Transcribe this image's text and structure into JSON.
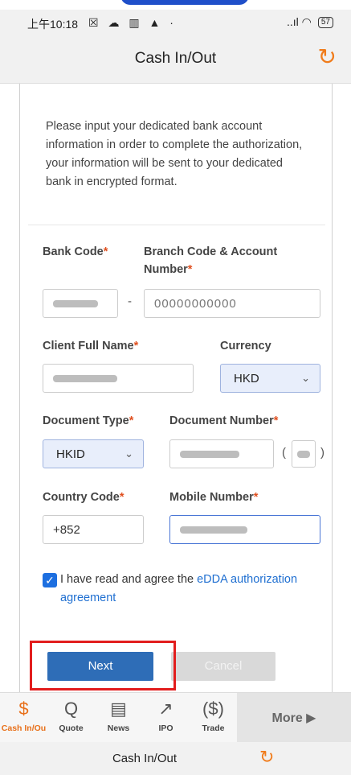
{
  "status": {
    "time": "上午10:18",
    "indicators": "☒ ☁ ▥ ▲ ·",
    "signal": "..ıl ◠",
    "battery": "57"
  },
  "header": {
    "title": "Cash In/Out",
    "refresh_icon": "↻"
  },
  "intro": "Please input your dedicated bank account information in order to complete the authorization, your information will be sent to your dedicated bank in encrypted format.",
  "form": {
    "bank_code_label": "Bank Code",
    "branch_account_label": "Branch Code & Account Number",
    "separator": "-",
    "account_number_value": "00000000000",
    "client_name_label": "Client Full Name",
    "currency_label": "Currency",
    "currency_value": "HKD",
    "doc_type_label": "Document Type",
    "doc_type_value": "HKID",
    "doc_number_label": "Document Number",
    "country_code_label": "Country Code",
    "country_code_value": "+852",
    "mobile_label": "Mobile Number",
    "required_mark": "*",
    "paren_open": "(",
    "paren_close": ")"
  },
  "agreement": {
    "text": "I have read and agree the ",
    "link": "eDDA authorization agreement"
  },
  "buttons": {
    "next": "Next",
    "cancel": "Cancel"
  },
  "tabs": [
    {
      "label": "Cash In/Ou",
      "icon": "$"
    },
    {
      "label": "Quote",
      "icon": "Q"
    },
    {
      "label": "News",
      "icon": "▤"
    },
    {
      "label": "IPO",
      "icon": "↗"
    },
    {
      "label": "Trade",
      "icon": "($)"
    }
  ],
  "more_label": "More ▶",
  "footer": {
    "title": "Cash In/Out",
    "refresh_icon": "↻"
  },
  "colors": {
    "accent": "#f07c1c",
    "primary": "#2e6db7",
    "highlight": "#e21d1d",
    "link": "#1f6fd1"
  }
}
